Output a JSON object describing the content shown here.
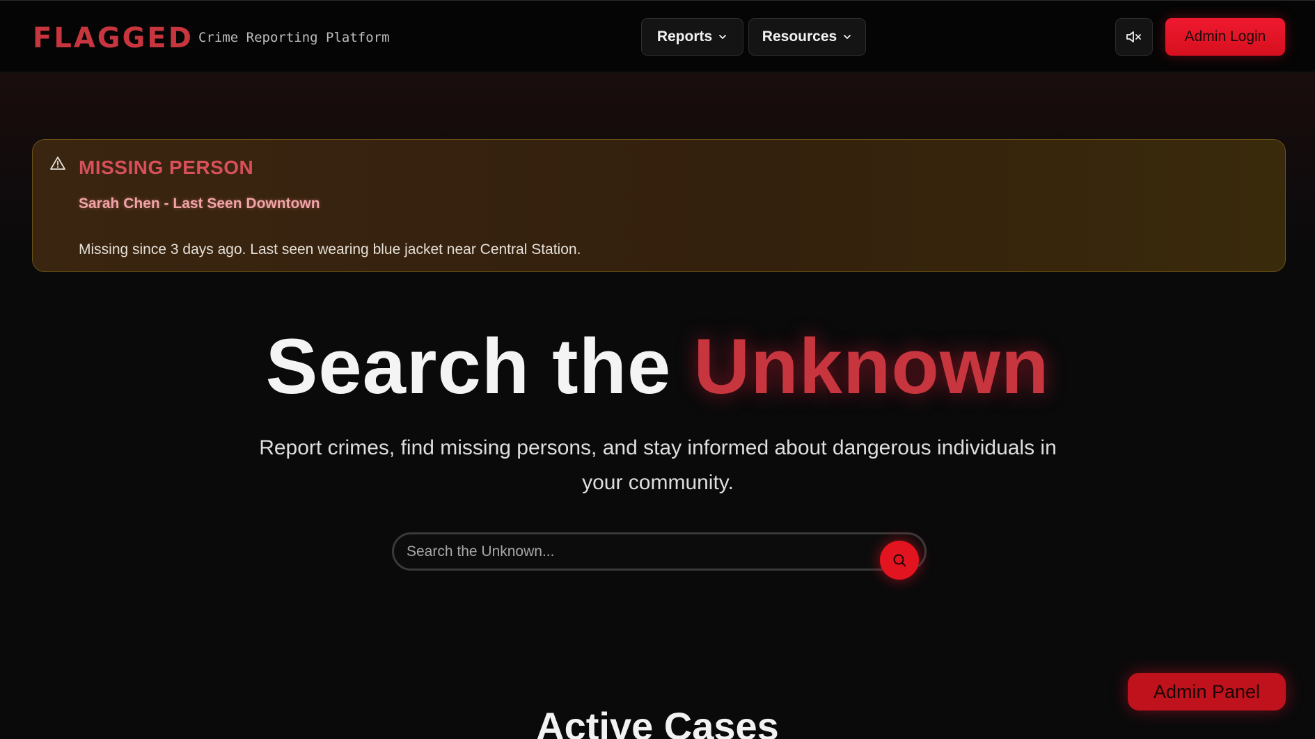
{
  "header": {
    "brand": "FLAGGED",
    "tagline": "Crime Reporting Platform",
    "nav": [
      {
        "label": "Reports",
        "icon": "chevron-down-icon"
      },
      {
        "label": "Resources",
        "icon": "chevron-down-icon"
      }
    ],
    "mute_icon": "volume-mute-icon",
    "admin_login_label": "Admin Login"
  },
  "alert": {
    "icon": "warning-triangle-icon",
    "title": "MISSING PERSON",
    "name": "Sarah Chen - Last Seen Downtown",
    "description": "Missing since 3 days ago. Last seen wearing blue jacket near Central Station."
  },
  "hero": {
    "title_plain": "Search the ",
    "title_accent": "Unknown",
    "subtitle": "Report crimes, find missing persons, and stay informed about dangerous individuals in your community.",
    "search_placeholder": "Search the Unknown...",
    "search_icon": "search-icon"
  },
  "sections": {
    "active_cases_title": "Active Cases"
  },
  "floating": {
    "admin_panel_label": "Admin Panel"
  },
  "colors": {
    "accent": "#c7363f",
    "button_red": "#e2141f",
    "alert_border": "#6a5214",
    "background": "#0a0a0b"
  }
}
